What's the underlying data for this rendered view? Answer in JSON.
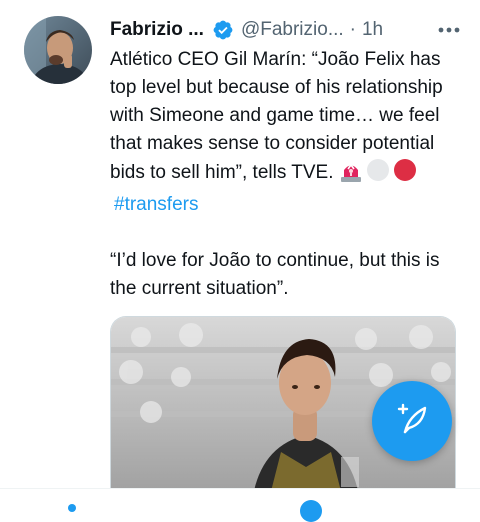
{
  "tweet": {
    "author_name": "Fabrizio ...",
    "handle": "@Fabrizio...",
    "separator": "·",
    "time": "1h",
    "more_label": "•••",
    "text_line1": "Atlético CEO Gil Marín: “João Felix has top level but because of his relationship with Simeone and game time… we feel that makes sense to consider potential bids to sell him”, tells TVE.",
    "hashtag": "#transfers",
    "text_line2": "“I’d love for João to continue, but this is the current situation”."
  },
  "icons": {
    "verified": "verified-badge-icon",
    "more": "more-options-icon",
    "siren_emoji": "siren-emoji",
    "white_circle_emoji": "white-circle-emoji",
    "red_circle_emoji": "red-circle-emoji",
    "compose": "compose-tweet-icon"
  },
  "colors": {
    "accent": "#1d9bf0",
    "text": "#0f1419",
    "secondary": "#536471"
  }
}
